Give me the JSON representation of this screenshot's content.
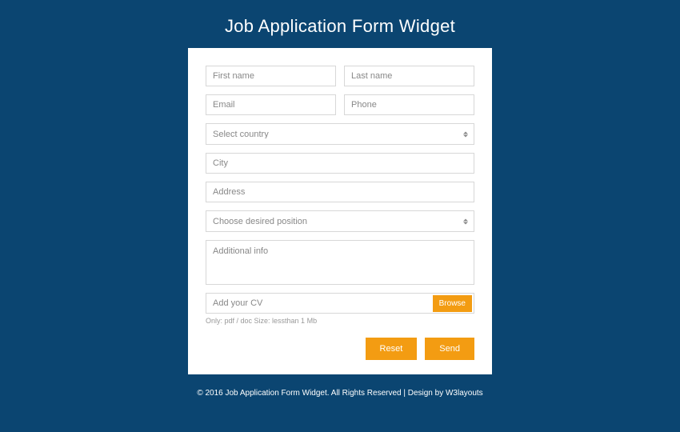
{
  "title": "Job Application Form Widget",
  "form": {
    "first_name_ph": "First name",
    "last_name_ph": "Last name",
    "email_ph": "Email",
    "phone_ph": "Phone",
    "country_ph": "Select country",
    "city_ph": "City",
    "address_ph": "Address",
    "position_ph": "Choose desired position",
    "additional_ph": "Additional info",
    "cv_ph": "Add your CV",
    "browse_label": "Browse",
    "cv_hint": "Only: pdf / doc Size: lessthan 1 Mb",
    "reset_label": "Reset",
    "send_label": "Send"
  },
  "footer": {
    "text": "© 2016 Job Application Form Widget. All Rights Reserved | Design by ",
    "link": "W3layouts"
  },
  "colors": {
    "bg": "#0b4571",
    "accent": "#f39c12"
  }
}
